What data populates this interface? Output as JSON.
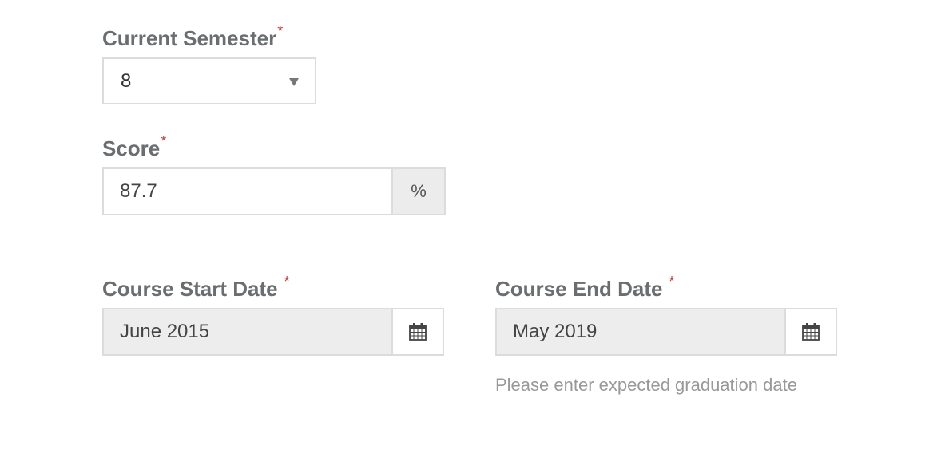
{
  "semester": {
    "label": "Current Semester",
    "required_mark": "*",
    "value": "8"
  },
  "score": {
    "label": "Score",
    "required_mark": "*",
    "value": "87.7",
    "unit": "%"
  },
  "start_date": {
    "label": "Course Start Date",
    "required_mark": "*",
    "value": "June 2015",
    "icon": "calendar-icon"
  },
  "end_date": {
    "label": "Course End Date",
    "required_mark": "*",
    "value": "May 2019",
    "icon": "calendar-icon",
    "help": "Please enter expected graduation date"
  },
  "colors": {
    "label": "#6a6e70",
    "required": "#b5403a",
    "border": "#dcdcdc",
    "disabled_bg": "#ededed",
    "help_text": "#999999"
  }
}
